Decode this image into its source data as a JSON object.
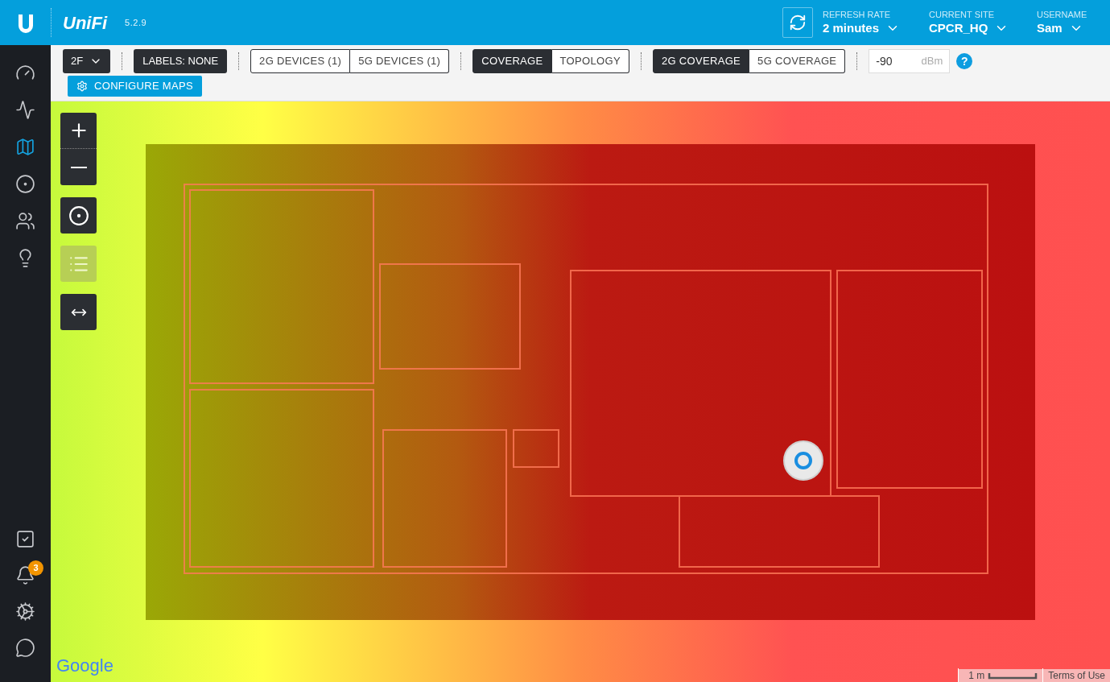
{
  "header": {
    "logo_text": "UniFi",
    "version": "5.2.9",
    "refresh": {
      "label": "REFRESH RATE",
      "value": "2 minutes"
    },
    "site": {
      "label": "CURRENT SITE",
      "value": "CPCR_HQ"
    },
    "user": {
      "label": "USERNAME",
      "value": "Sam"
    }
  },
  "sidebar": {
    "items": [
      {
        "kind": "dashboard",
        "selected": false
      },
      {
        "kind": "statistics",
        "selected": false
      },
      {
        "kind": "map",
        "selected": true
      },
      {
        "kind": "devices",
        "selected": false
      },
      {
        "kind": "clients",
        "selected": false
      },
      {
        "kind": "insights",
        "selected": false
      }
    ],
    "bottom_items": [
      {
        "kind": "tasks"
      },
      {
        "kind": "alerts",
        "badge": "3"
      },
      {
        "kind": "settings"
      },
      {
        "kind": "chat"
      }
    ]
  },
  "toolbar": {
    "floor": "2F",
    "labels": "LABELS: NONE",
    "devices": [
      {
        "label": "2G DEVICES (1)",
        "selected": false
      },
      {
        "label": "5G DEVICES (1)",
        "selected": false
      }
    ],
    "views": [
      {
        "label": "COVERAGE",
        "selected": true
      },
      {
        "label": "TOPOLOGY",
        "selected": false
      }
    ],
    "bands": [
      {
        "label": "2G COVERAGE",
        "selected": true
      },
      {
        "label": "5G COVERAGE",
        "selected": false
      }
    ],
    "signal": {
      "value": "-90",
      "unit": "dBm"
    },
    "help": "?",
    "configure": "CONFIGURE MAPS"
  },
  "map": {
    "tools": [
      {
        "kind": "zoom-in",
        "selected": false
      },
      {
        "kind": "zoom-out",
        "selected": false
      },
      {
        "kind": "locate",
        "selected": false
      },
      {
        "kind": "list",
        "selected": true
      },
      {
        "kind": "fit",
        "selected": false
      }
    ],
    "google": "Google",
    "scale": "1 m",
    "terms": "Terms of Use"
  }
}
